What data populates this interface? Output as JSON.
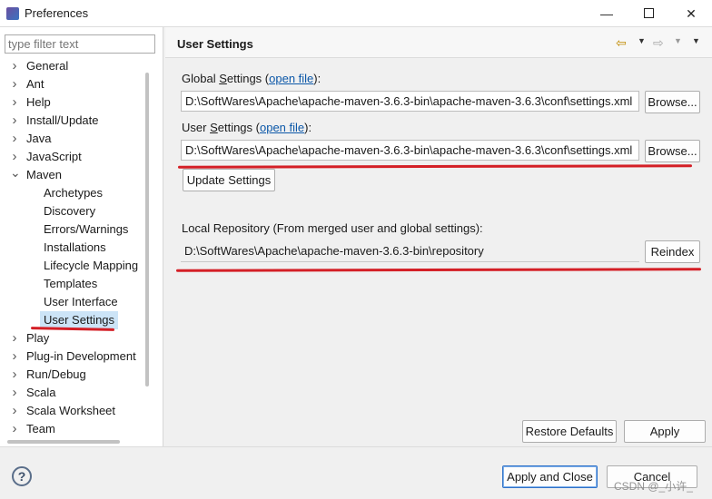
{
  "window": {
    "title": "Preferences"
  },
  "sidebar": {
    "filter_placeholder": "type filter text",
    "items": [
      {
        "label": "General",
        "expander": "›"
      },
      {
        "label": "Ant",
        "expander": "›"
      },
      {
        "label": "Help",
        "expander": "›"
      },
      {
        "label": "Install/Update",
        "expander": "›"
      },
      {
        "label": "Java",
        "expander": "›"
      },
      {
        "label": "JavaScript",
        "expander": "›"
      },
      {
        "label": "Maven",
        "expander": "⌄"
      },
      {
        "label": "Archetypes"
      },
      {
        "label": "Discovery"
      },
      {
        "label": "Errors/Warnings"
      },
      {
        "label": "Installations"
      },
      {
        "label": "Lifecycle Mapping"
      },
      {
        "label": "Templates"
      },
      {
        "label": "User Interface"
      },
      {
        "label": "User Settings",
        "selected": true
      },
      {
        "label": "Play",
        "expander": "›"
      },
      {
        "label": "Plug-in Development",
        "expander": "›"
      },
      {
        "label": "Run/Debug",
        "expander": "›"
      },
      {
        "label": "Scala",
        "expander": "›"
      },
      {
        "label": "Scala Worksheet",
        "expander": "›"
      },
      {
        "label": "Team",
        "expander": "›"
      }
    ]
  },
  "page": {
    "title": "User Settings",
    "global": {
      "label_prefix": "Global ",
      "label_mnemonic": "S",
      "label_rest": "ettings (",
      "link": "open file",
      "label_end": "):",
      "path": "D:\\SoftWares\\Apache\\apache-maven-3.6.3-bin\\apache-maven-3.6.3\\conf\\settings.xml",
      "browse": "Browse..."
    },
    "user": {
      "label_prefix": "User ",
      "label_mnemonic": "S",
      "label_rest": "ettings (",
      "link": "open file",
      "label_end": "):",
      "path": "D:\\SoftWares\\Apache\\apache-maven-3.6.3-bin\\apache-maven-3.6.3\\conf\\settings.xml",
      "browse": "Browse..."
    },
    "update_button": "Update Settings",
    "local_repo": {
      "label": "Local Repository (From merged user and global settings):",
      "path": "D:\\SoftWares\\Apache\\apache-maven-3.6.3-bin\\repository",
      "reindex": "Reindex"
    },
    "restore_defaults": "Restore Defaults",
    "apply": "Apply"
  },
  "footer": {
    "help": "?",
    "apply_close": "Apply and Close",
    "cancel": "Cancel"
  },
  "watermark": "CSDN @_小许_",
  "colors": {
    "annotation": "#d41f26",
    "selection": "#cce4f7",
    "link": "#0b57a8"
  }
}
